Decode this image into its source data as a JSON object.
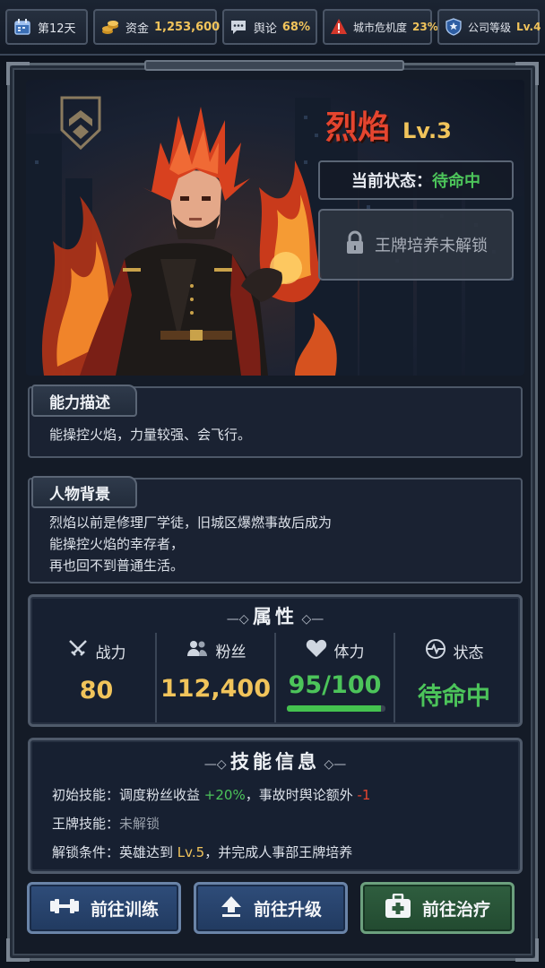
{
  "topbar": {
    "day": "第12天",
    "funds_label": "资金",
    "funds_value": "1,253,600",
    "opinion_label": "舆论",
    "opinion_value": "68%",
    "crisis_label": "城市危机度",
    "crisis_value": "23%",
    "company_label": "公司等级",
    "company_value": "Lv.4"
  },
  "hero": {
    "name": "烈焰",
    "level": "Lv.3",
    "state_label": "当前状态：",
    "state_value": "待命中",
    "ace_locked_text": "王牌培养未解锁"
  },
  "ability": {
    "title": "能力描述",
    "text": "能操控火焰，力量较强、会飞行。"
  },
  "background": {
    "title": "人物背景",
    "lines": [
      "烈焰以前是修理厂学徒，旧城区爆燃事故后成为",
      "能操控火焰的幸存者，",
      "再也回不到普通生活。"
    ]
  },
  "attributes": {
    "title": "属性",
    "power_label": "战力",
    "power_value": "80",
    "fans_label": "粉丝",
    "fans_value": "112,400",
    "stamina_label": "体力",
    "stamina_value": "95/100",
    "stamina_fraction": 0.95,
    "status_label": "状态",
    "status_value": "待命中"
  },
  "skills": {
    "title": "技能信息",
    "initial_label": "初始技能：",
    "initial_text_1": "调度粉丝收益 ",
    "initial_bonus": "+20%",
    "initial_text_2": "，事故时舆论额外 ",
    "initial_penalty": "-1",
    "ace_label": "王牌技能：",
    "ace_value": "未解锁",
    "unlock_label": "解锁条件：",
    "unlock_text_1": "英雄达到 ",
    "unlock_level": "Lv.5",
    "unlock_text_2": "，并完成人事部王牌培养"
  },
  "buttons": {
    "train": "前往训练",
    "upgrade": "前往升级",
    "heal": "前往治疗"
  },
  "colors": {
    "gold": "#f1c45b",
    "green": "#4cc45a",
    "red": "#e5452f",
    "blue_button": "#2f4d7a",
    "green_button": "#2f5e3f"
  },
  "icons": [
    "calendar-icon",
    "coins-icon",
    "chat-icon",
    "warning-icon",
    "shield-icon",
    "crossed-swords-icon",
    "people-icon",
    "heart-icon",
    "pulse-icon",
    "lock-icon",
    "dumbbell-icon",
    "upload-arrow-icon",
    "first-aid-icon",
    "emblem-icon"
  ]
}
